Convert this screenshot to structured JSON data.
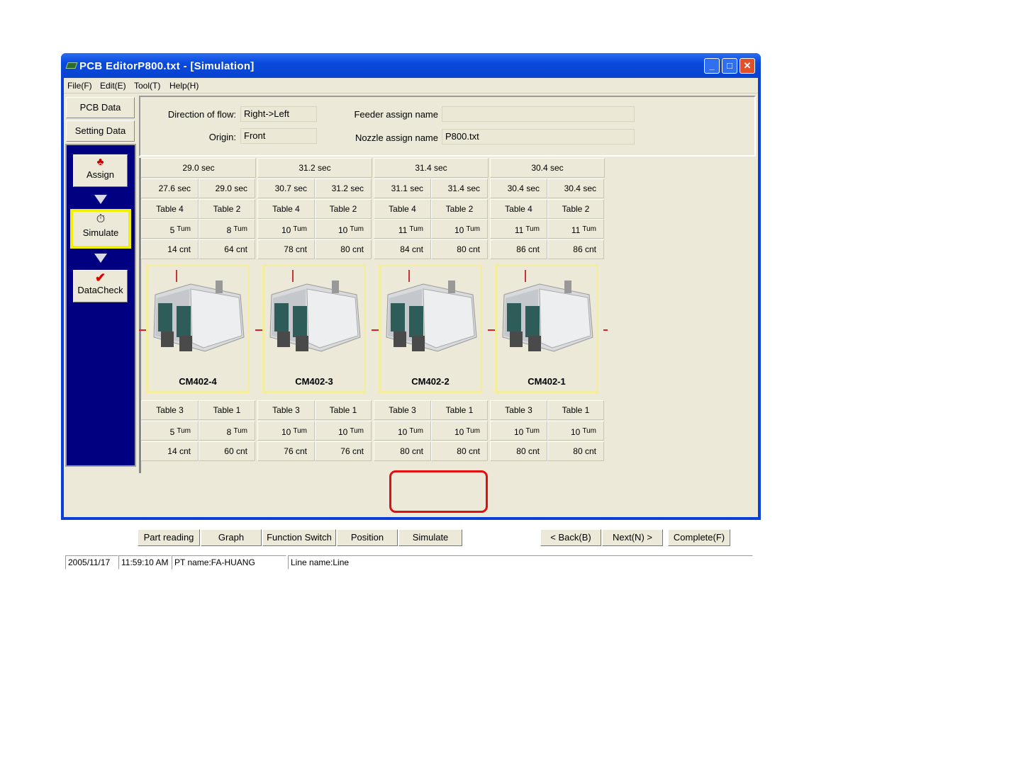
{
  "window": {
    "title": "PCB EditorP800.txt - [Simulation]",
    "controls": [
      "_",
      "□",
      "✕"
    ]
  },
  "menu": [
    "File(F)",
    "Edit(E)",
    "Tool(T)",
    "Help(H)"
  ],
  "nav": {
    "pcb_data": "PCB Data",
    "setting_data": "Setting Data",
    "steps": [
      {
        "label": "Assign",
        "icon": "assign-icon"
      },
      {
        "label": "Simulate",
        "icon": "stopwatch-icon"
      },
      {
        "label": "DataCheck",
        "icon": "checkmark-icon"
      }
    ]
  },
  "info": {
    "direction_label": "Direction of flow:",
    "direction_value": "Right->Left",
    "origin_label": "Origin:",
    "origin_value": "Front",
    "feeder_label": "Feeder assign name",
    "feeder_value": "",
    "nozzle_label": "Nozzle assign name",
    "nozzle_value": "P800.txt"
  },
  "machines": [
    {
      "name": "CM402-4",
      "total": "29.0 sec",
      "top": [
        {
          "time": "27.6 sec",
          "table": "Table 4",
          "turn": "5",
          "cnt": "14 cnt"
        },
        {
          "time": "29.0 sec",
          "table": "Table 2",
          "turn": "8",
          "cnt": "64 cnt"
        }
      ],
      "bottom": [
        {
          "table": "Table 3",
          "turn": "5",
          "cnt": "14 cnt"
        },
        {
          "table": "Table 1",
          "turn": "8",
          "cnt": "60 cnt"
        }
      ]
    },
    {
      "name": "CM402-3",
      "total": "31.2 sec",
      "top": [
        {
          "time": "30.7 sec",
          "table": "Table 4",
          "turn": "10",
          "cnt": "78 cnt"
        },
        {
          "time": "31.2 sec",
          "table": "Table 2",
          "turn": "10",
          "cnt": "80 cnt"
        }
      ],
      "bottom": [
        {
          "table": "Table 3",
          "turn": "10",
          "cnt": "76 cnt"
        },
        {
          "table": "Table 1",
          "turn": "10",
          "cnt": "76 cnt"
        }
      ]
    },
    {
      "name": "CM402-2",
      "total": "31.4 sec",
      "top": [
        {
          "time": "31.1 sec",
          "table": "Table 4",
          "turn": "11",
          "cnt": "84 cnt"
        },
        {
          "time": "31.4 sec",
          "table": "Table 2",
          "turn": "10",
          "cnt": "80 cnt"
        }
      ],
      "bottom": [
        {
          "table": "Table 3",
          "turn": "10",
          "cnt": "80 cnt"
        },
        {
          "table": "Table 1",
          "turn": "10",
          "cnt": "80 cnt"
        }
      ]
    },
    {
      "name": "CM402-1",
      "total": "30.4 sec",
      "top": [
        {
          "time": "30.4 sec",
          "table": "Table 4",
          "turn": "11",
          "cnt": "86 cnt"
        },
        {
          "time": "30.4 sec",
          "table": "Table 2",
          "turn": "11",
          "cnt": "86 cnt"
        }
      ],
      "bottom": [
        {
          "table": "Table 3",
          "turn": "10",
          "cnt": "80 cnt"
        },
        {
          "table": "Table 1",
          "turn": "10",
          "cnt": "80 cnt"
        }
      ]
    }
  ],
  "turn_unit": "Tum",
  "buttons": {
    "part_reading": "Part reading",
    "graph": "Graph",
    "function_switch": "Function Switch",
    "position": "Position",
    "simulate": "Simulate",
    "back": "< Back(B)",
    "next": "Next(N) >",
    "complete": "Complete(F)"
  },
  "status": {
    "date": "2005/11/17",
    "time": "11:59:10 AM",
    "pt_name": "PT name:FA-HUANG",
    "line_name": "Line name:Line"
  },
  "colors": {
    "highlight": "#f0f000",
    "annotation": "#e01010",
    "nav_bg": "#000080"
  }
}
